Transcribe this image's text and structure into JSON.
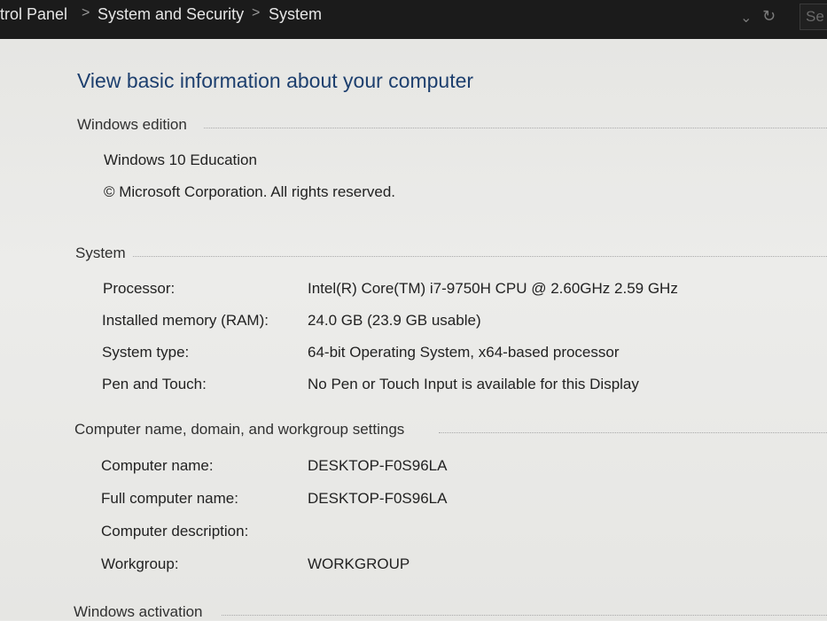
{
  "breadcrumb": {
    "items": [
      "trol Panel",
      "System and Security",
      "System"
    ],
    "separator": ">",
    "search_fragment": "Se"
  },
  "page": {
    "title": "View basic information about your computer"
  },
  "windows_edition": {
    "heading": "Windows edition",
    "edition": "Windows 10 Education",
    "copyright": "© Microsoft Corporation. All rights reserved."
  },
  "system": {
    "heading": "System",
    "rows": [
      {
        "label": "Processor:",
        "value": "Intel(R) Core(TM) i7-9750H CPU @ 2.60GHz   2.59 GHz"
      },
      {
        "label": "Installed memory (RAM):",
        "value": "24.0 GB (23.9 GB usable)"
      },
      {
        "label": "System type:",
        "value": "64-bit Operating System, x64-based processor"
      },
      {
        "label": "Pen and Touch:",
        "value": "No Pen or Touch Input is available for this Display"
      }
    ]
  },
  "computer_name": {
    "heading": "Computer name, domain, and workgroup settings",
    "rows": [
      {
        "label": "Computer name:",
        "value": "DESKTOP-F0S96LA"
      },
      {
        "label": "Full computer name:",
        "value": "DESKTOP-F0S96LA"
      },
      {
        "label": "Computer description:",
        "value": ""
      },
      {
        "label": "Workgroup:",
        "value": "WORKGROUP"
      }
    ]
  },
  "activation": {
    "heading": "Windows activation"
  },
  "theme": {
    "title_color": "#1d3f6e",
    "address_bar_bg": "#1b1b1b"
  }
}
